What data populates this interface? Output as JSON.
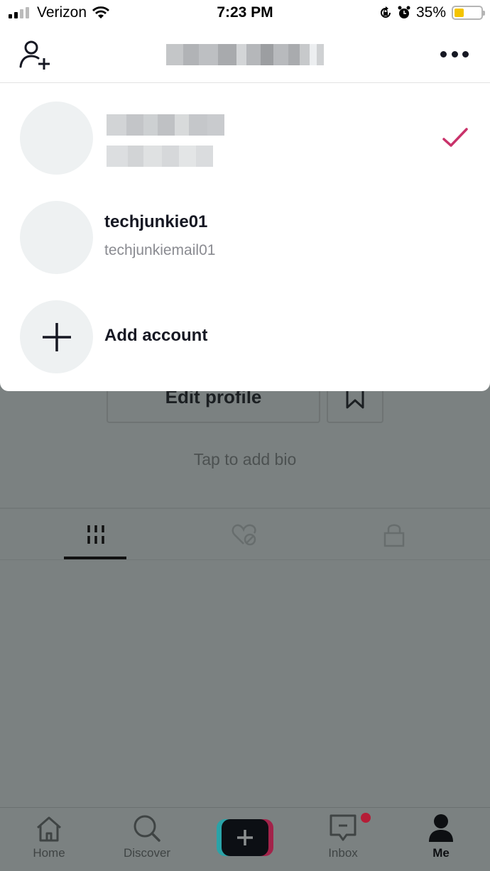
{
  "status_bar": {
    "carrier": "Verizon",
    "time": "7:23 PM",
    "battery_percent": "35%",
    "battery_level": 0.35,
    "icons": [
      "signal-icon",
      "wifi-icon",
      "orientation-lock-icon",
      "alarm-icon",
      "battery-icon"
    ]
  },
  "header": {
    "title": "[redacted]",
    "add_user_icon": "add-user-icon",
    "more_icon": "more-options-icon"
  },
  "account_switcher": {
    "accounts": [
      {
        "username": "[redacted]",
        "handle": "[redacted]",
        "selected": true
      },
      {
        "username": "techjunkie01",
        "handle": "techjunkiemail01",
        "selected": false
      }
    ],
    "add_account_label": "Add account",
    "check_color": "#c9326a"
  },
  "profile": {
    "edit_profile_label": "Edit profile",
    "bio_placeholder": "Tap to add bio",
    "tabs": [
      {
        "name": "videos",
        "icon": "grid-icon",
        "active": true
      },
      {
        "name": "liked",
        "icon": "liked-hidden-icon",
        "active": false
      },
      {
        "name": "private",
        "icon": "lock-icon",
        "active": false
      }
    ]
  },
  "bottom_nav": {
    "items": [
      {
        "label": "Home",
        "icon": "home-icon",
        "active": false
      },
      {
        "label": "Discover",
        "icon": "search-icon",
        "active": false
      },
      {
        "label": "",
        "icon": "create-plus-icon",
        "active": false
      },
      {
        "label": "Inbox",
        "icon": "inbox-icon",
        "active": false,
        "has_badge": true
      },
      {
        "label": "Me",
        "icon": "profile-icon",
        "active": true
      }
    ]
  },
  "colors": {
    "accent_pink": "#c9326a",
    "dim_overlay": "#7b8181",
    "badge_red": "#b51d37"
  }
}
